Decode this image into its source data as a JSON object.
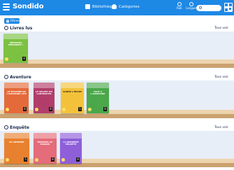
{
  "header": {
    "app_name": "Sondido",
    "nav": [
      {
        "label": "Bibliothèque",
        "icon": "library-icon"
      },
      {
        "label": "Catégories",
        "icon": "categories-icon"
      }
    ],
    "toggles": [
      {
        "label": "Rall.",
        "icon": "speed-icon"
      },
      {
        "label": "Langues",
        "icon": "globe-icon"
      }
    ],
    "search_placeholder": ""
  },
  "filter_button": "Filtres",
  "sections": [
    {
      "title": "Livres lus",
      "see_all": "Tous voir",
      "books": [
        {
          "title": "PRESSPRA PRÉSIDENT !",
          "number": "4",
          "color": "#7cc142"
        }
      ]
    },
    {
      "title": "Aventure",
      "see_all": "Tous voir",
      "books": [
        {
          "title": "LE MYSTÈRE DE L'ANCIENNE CITÉ",
          "number": "8",
          "color": "#e46a3a"
        },
        {
          "title": "LE SECRET DU LABYRINTHE",
          "number": "8",
          "color": "#b23d6b"
        },
        {
          "title": "SONNE L'HEURE",
          "number": "5",
          "color": "#f3c23a"
        },
        {
          "title": "FACE À L'AVENTURE",
          "number": "8",
          "color": "#4aa84a"
        }
      ]
    },
    {
      "title": "Enquête",
      "see_all": "Tous voir",
      "books": [
        {
          "title": "AU CRIMINEL",
          "number": "5",
          "color": "#e8812f"
        },
        {
          "title": "MEURTRE AU MANOIR",
          "number": "8",
          "color": "#e56c7a"
        },
        {
          "title": "LA DERNIÈRE ENQUÊTE",
          "number": "9",
          "color": "#8e5fd9"
        }
      ]
    }
  ],
  "colors": {
    "brand": "#1e88e5",
    "shelf": "#caa26f",
    "shelf_wall": "#e8eef7",
    "section_text": "#1b2b4b"
  }
}
